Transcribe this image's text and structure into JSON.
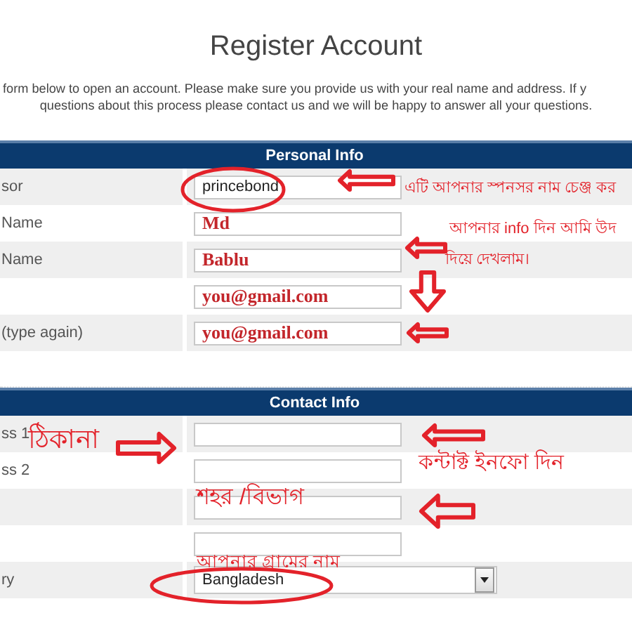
{
  "title": "Register Account",
  "intro": [
    "form below to open an account. Please make sure you provide us with your real name and address. If y",
    "questions about this process please contact us and we will be happy to answer all your questions."
  ],
  "sections": [
    {
      "title": "Personal Info",
      "rows": [
        {
          "label": "sor",
          "kind": "input",
          "value": "princebond",
          "handwritten": false
        },
        {
          "label": "Name",
          "kind": "input",
          "value": "Md",
          "handwritten": true
        },
        {
          "label": "Name",
          "kind": "input",
          "value": "Bablu",
          "handwritten": true
        },
        {
          "kind": "input",
          "value": "you@gmail.com",
          "handwritten": true
        },
        {
          "label": "(type again)",
          "kind": "input",
          "value": "you@gmail.com",
          "handwritten": true
        }
      ]
    },
    {
      "title": "Contact Info",
      "rows": [
        {
          "label": "ss 1",
          "kind": "input"
        },
        {
          "label": "ss 2",
          "kind": "input"
        },
        {
          "kind": "input"
        },
        {
          "kind": "input"
        },
        {
          "label": "ry",
          "kind": "select",
          "value": "Bangladesh"
        }
      ]
    }
  ],
  "annotations": [
    {
      "text": "এটি আপনার স্পনসর নাম চেঞ্জ কর"
    },
    {
      "text": "আপনার info দিন আমি উদ"
    },
    {
      "text": "দিয়ে দেখলাম।"
    },
    {
      "text": "ঠিকানা"
    },
    {
      "text": "কন্টাক্ট ইনফো দিন"
    },
    {
      "text": "শহর /বিভাগ"
    },
    {
      "text": "আপনার গ্রামের নাম"
    }
  ]
}
